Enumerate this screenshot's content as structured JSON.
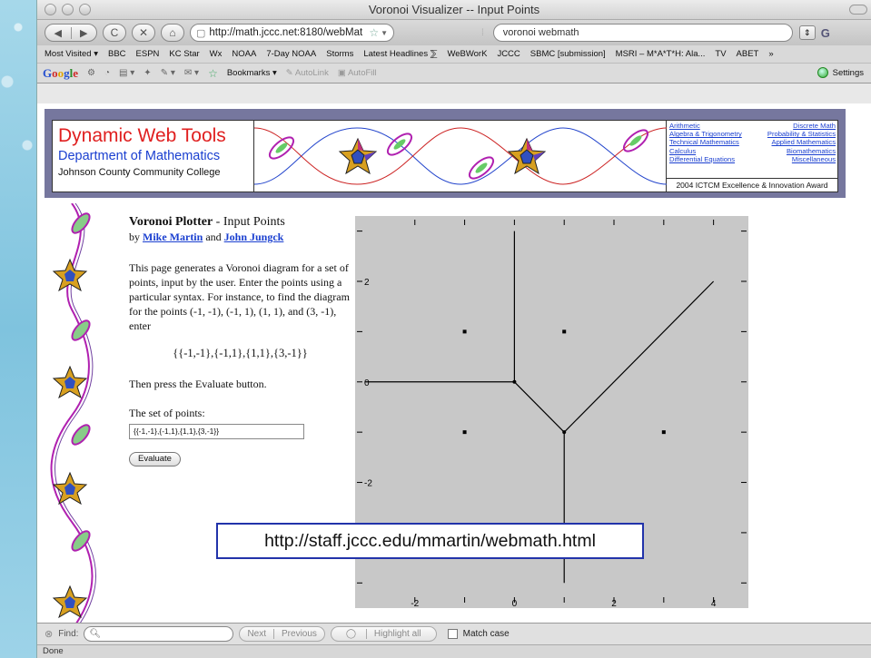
{
  "window": {
    "title": "Voronoi Visualizer -- Input Points"
  },
  "nav": {
    "back": "◀",
    "forward": "▶",
    "reload": "C",
    "stop": "✕",
    "home": "⌂",
    "url": "http://math.jccc.net:8180/webMat",
    "search_value": "voronoi webmath",
    "search_engine": "G"
  },
  "bookmarks": [
    "Most Visited ▾",
    "BBC",
    "ESPN",
    "KC Star",
    "Wx",
    "NOAA",
    "7-Day NOAA",
    "Storms",
    "Latest Headlines ⅀",
    "WeBWorK",
    "JCCC",
    "SBMC [submission]",
    "MSRI – M*A*T*H: Ala...",
    "TV",
    "ABET",
    "»"
  ],
  "googlebar": {
    "logo": [
      "G",
      "o",
      "o",
      "g",
      "l",
      "e"
    ],
    "bookmarks_label": "Bookmarks ▾",
    "autolink": "AutoLink",
    "autofill": "AutoFill",
    "settings": "Settings"
  },
  "banner": {
    "title": "Dynamic Web Tools",
    "dept": "Department of Mathematics",
    "college": "Johnson County Community College",
    "links_left": [
      "Arithmetic",
      "Algebra & Trigonometry",
      "Technical Mathematics",
      "Calculus",
      "Differential Equations"
    ],
    "links_right": [
      "Discrete Math",
      "Probability & Statistics",
      "Applied Mathematics",
      "Biomathematics",
      "Miscellaneous"
    ],
    "award": "2004 ICTCM Excellence & Innovation Award"
  },
  "page": {
    "heading": "Voronoi Plotter",
    "heading_suffix": " - Input Points",
    "by": "by ",
    "author1": "Mike Martin",
    "and": " and ",
    "author2": "John Jungck",
    "description": "This page generates a Voronoi diagram for a set of points, input by the user. Enter the points using a particular syntax. For instance, to find the diagram for the points (-1, -1), (-1, 1), (1, 1), and (3, -1), enter",
    "example": "{{-1,-1},{-1,1},{1,1},{3,-1}}",
    "instruction": "Then press the Evaluate button.",
    "input_label": "The set of points:",
    "input_value": "{{-1,-1},{-1,1},{1,1},{3,-1}}",
    "evaluate_label": "Evaluate"
  },
  "plot": {
    "x_ticks": [
      "-2",
      "0",
      "2",
      "4"
    ],
    "y_ticks": [
      "2",
      "0",
      "-2"
    ],
    "points": [
      [
        -1,
        -1
      ],
      [
        -1,
        1
      ],
      [
        1,
        1
      ],
      [
        3,
        -1
      ]
    ],
    "vertices": [
      [
        0,
        0
      ],
      [
        1,
        -1
      ]
    ],
    "edges": [
      [
        [
          0,
          0
        ],
        [
          0,
          3
        ]
      ],
      [
        [
          0,
          0
        ],
        [
          -3,
          0
        ]
      ],
      [
        [
          0,
          0
        ],
        [
          1,
          -1
        ]
      ],
      [
        [
          1,
          -1
        ],
        [
          1,
          -4
        ]
      ],
      [
        [
          1,
          -1
        ],
        [
          4,
          2
        ]
      ]
    ],
    "xlim": [
      -3.2,
      4.7
    ],
    "ylim": [
      -4.5,
      3.3
    ]
  },
  "callout": "http://staff.jccc.edu/mmartin/webmath.html",
  "findbar": {
    "label": "Find:",
    "next": "Next",
    "previous": "Previous",
    "highlight": "Highlight all",
    "matchcase": "Match case"
  },
  "status": "Done"
}
